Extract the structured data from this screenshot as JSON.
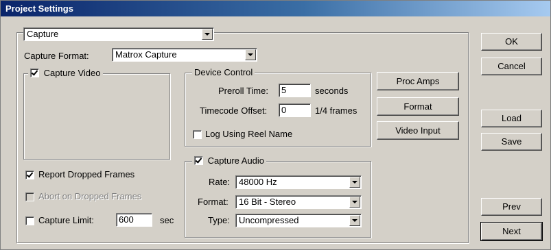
{
  "window": {
    "title": "Project Settings"
  },
  "top_combo": {
    "value": "Capture"
  },
  "capture_format": {
    "label": "Capture Format:",
    "value": "Matrox Capture"
  },
  "capture_video": {
    "label": "Capture Video",
    "checked": true
  },
  "device_control": {
    "title": "Device Control",
    "preroll_label": "Preroll Time:",
    "preroll_value": "5",
    "preroll_unit": "seconds",
    "timecode_label": "Timecode Offset:",
    "timecode_value": "0",
    "timecode_unit": "1/4 frames",
    "log_reel_label": "Log Using Reel Name",
    "log_reel_checked": false
  },
  "report_dropped": {
    "label": "Report Dropped Frames",
    "checked": true
  },
  "abort_dropped": {
    "label": "Abort on Dropped Frames",
    "checked": false,
    "enabled": false
  },
  "capture_limit": {
    "label": "Capture Limit:",
    "checked": false,
    "value": "600",
    "unit": "sec"
  },
  "capture_audio": {
    "title": "Capture Audio",
    "checked": true,
    "rate_label": "Rate:",
    "rate_value": "48000 Hz",
    "format_label": "Format:",
    "format_value": "16 Bit - Stereo",
    "type_label": "Type:",
    "type_value": "Uncompressed"
  },
  "side_buttons": {
    "proc_amps": "Proc Amps",
    "format": "Format",
    "video_input": "Video Input"
  },
  "right_buttons": {
    "ok": "OK",
    "cancel": "Cancel",
    "load": "Load",
    "save": "Save",
    "prev": "Prev",
    "next": "Next"
  },
  "colors": {
    "face": "#d4d0c8",
    "title_start": "#0a246a",
    "title_end": "#a6caf0"
  }
}
